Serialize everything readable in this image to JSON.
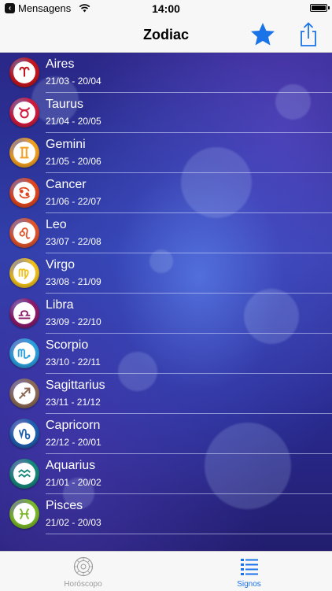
{
  "status_bar": {
    "carrier": "Mensagens",
    "time": "14:00"
  },
  "nav": {
    "title": "Zodiac",
    "favorite_icon": "star-icon",
    "share_icon": "share-icon"
  },
  "signs": [
    {
      "name": "Aires",
      "dates": "21/03 - 20/04",
      "color": "#c5161d",
      "icon": "aries-icon"
    },
    {
      "name": "Taurus",
      "dates": "21/04 - 20/05",
      "color": "#d01a3e",
      "icon": "taurus-icon"
    },
    {
      "name": "Gemini",
      "dates": "21/05 - 20/06",
      "color": "#f3a021",
      "icon": "gemini-icon"
    },
    {
      "name": "Cancer",
      "dates": "21/06 - 22/07",
      "color": "#e2461d",
      "icon": "cancer-icon"
    },
    {
      "name": "Leo",
      "dates": "23/07 - 22/08",
      "color": "#e0542b",
      "icon": "leo-icon"
    },
    {
      "name": "Virgo",
      "dates": "23/08 - 21/09",
      "color": "#f0c01c",
      "icon": "virgo-icon"
    },
    {
      "name": "Libra",
      "dates": "23/09 - 22/10",
      "color": "#8c1a6b",
      "icon": "libra-icon"
    },
    {
      "name": "Scorpio",
      "dates": "23/10 - 22/11",
      "color": "#2aa0dd",
      "icon": "scorpio-icon"
    },
    {
      "name": "Sagittarius",
      "dates": "23/11 - 21/12",
      "color": "#8b6a55",
      "icon": "sagittarius-icon"
    },
    {
      "name": "Capricorn",
      "dates": "22/12 - 20/01",
      "color": "#1f5fae",
      "icon": "capricorn-icon"
    },
    {
      "name": "Aquarius",
      "dates": "21/01 - 20/02",
      "color": "#16877a",
      "icon": "aquarius-icon"
    },
    {
      "name": "Pisces",
      "dates": "21/02 - 20/03",
      "color": "#7ab928",
      "icon": "pisces-icon"
    }
  ],
  "tabs": [
    {
      "label": "Horóscopo",
      "icon": "horoscope-wheel-icon",
      "active": false
    },
    {
      "label": "Signos",
      "icon": "list-icon",
      "active": true
    }
  ],
  "colors": {
    "accent": "#1b73e8",
    "inactive_tab": "#9b9b9b"
  }
}
